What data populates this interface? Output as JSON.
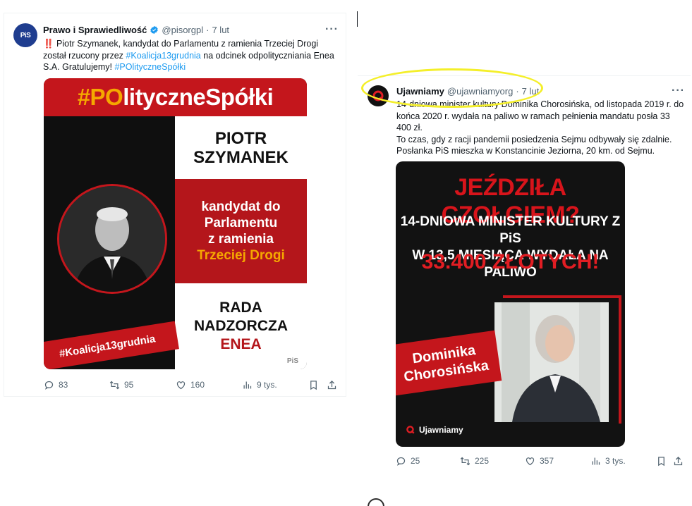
{
  "left_tweet": {
    "author_name": "Prawo i Sprawiedliwość",
    "handle": "@pisorgpl",
    "separator": "·",
    "time": "7 lut",
    "avatar_text": "PiS",
    "text_bang": "‼️",
    "text_part1": " Piotr Szymanek, kandydat do Parlamentu z ramienia Trzeciej Drogi",
    "text_part2": "został rzucony przez ",
    "hashtag1": "#Koalicja13grudnia",
    "text_part3": " na odcinek odpolityczniania Enea",
    "text_part4": "S.A. Gratulujemy! ",
    "hashtag2": "#POlityczneSpółki",
    "media": {
      "header_po": "#PO",
      "header_rest": "lityczneSpółki",
      "name_line1": "PIOTR",
      "name_line2": "SZYMANEK",
      "desc_line1": "kandydat do",
      "desc_line2": "Parlamentu",
      "desc_line3": "z ramienia",
      "desc_line4": "Trzeciej Drogi",
      "board_line1": "RADA",
      "board_line2": "NADZORCZA",
      "board_line3": "ENEA",
      "ribbon": "#Koalicja13grudnia",
      "watermark": "PiS"
    },
    "stats": {
      "replies": "83",
      "reposts": "95",
      "likes": "160",
      "views": "9 tys."
    }
  },
  "right_tweet": {
    "author_name": "Ujawniamy",
    "handle": "@ujawniamyorg",
    "separator": "·",
    "time": "7 lut",
    "text_line1": "14-dniowa minister kultury Dominika Chorosińska, od listopada 2019 r. do",
    "text_line2": "końca 2020 r. wydała na paliwo w ramach pełnienia mandatu posła 33",
    "text_line3": "400 zł.",
    "text_line4": "To czas, gdy z racji pandemii posiedzenia Sejmu odbywały się zdalnie.",
    "text_line5": "Posłanka PiS mieszka w Konstancinie Jeziorna, 20 km. od Sejmu.",
    "media": {
      "headline": "JEŹDZIŁA CZOŁGIEM?",
      "sub_line1": "14-DNIOWA MINISTER KULTURY Z PiS",
      "sub_line2": "W 13,5 MIESIĄCA WYDAŁA NA PALIWO",
      "amount": "33.400 ZŁOTYCH!",
      "name_line1": "Dominika",
      "name_line2": "Chorosińska",
      "brand": "Ujawniamy"
    },
    "stats": {
      "replies": "25",
      "reposts": "225",
      "likes": "357",
      "views": "3 tys."
    }
  },
  "colors": {
    "link": "#1d9bf0",
    "muted": "#536471",
    "pis_red": "#c4161c",
    "highlight": "#f4ef2a"
  }
}
